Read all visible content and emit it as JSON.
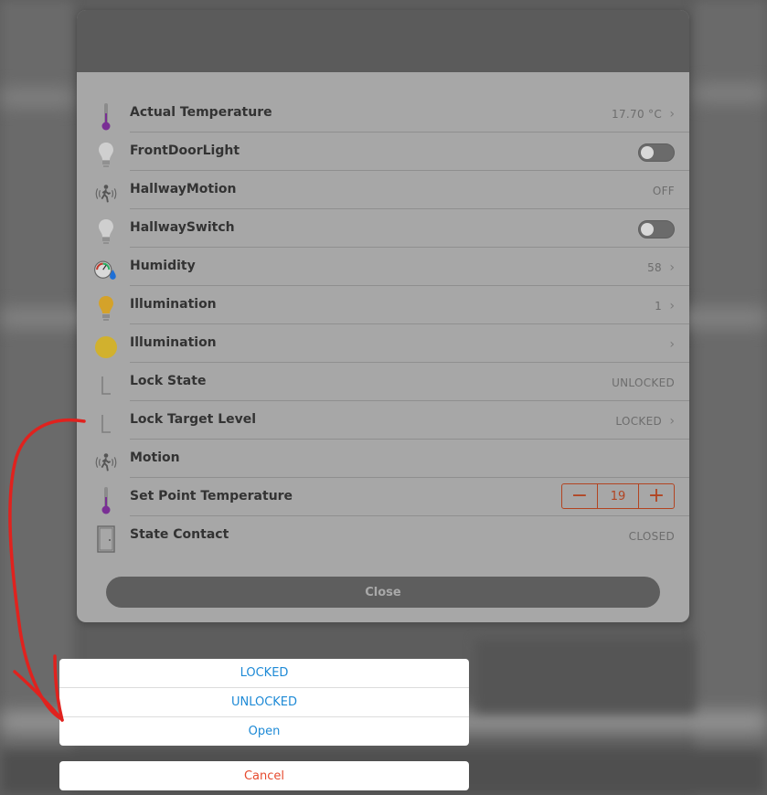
{
  "dialog": {
    "rows": [
      {
        "label": "Actual Temperature",
        "value": "17.70 °C",
        "icon": "thermometer-icon"
      },
      {
        "label": "FrontDoorLight",
        "icon": "lightbulb-icon"
      },
      {
        "label": "HallwayMotion",
        "value": "OFF",
        "icon": "motion-icon"
      },
      {
        "label": "HallwaySwitch",
        "icon": "lightbulb-icon"
      },
      {
        "label": "Humidity",
        "value": "58",
        "icon": "humidity-gauge-icon"
      },
      {
        "label": "Illumination",
        "value": "1",
        "icon": "lightbulb-on-icon"
      },
      {
        "label": "Illumination",
        "icon": "sun-icon"
      },
      {
        "label": "Lock State",
        "value": "UNLOCKED",
        "icon": "lock-state-icon"
      },
      {
        "label": "Lock Target Level",
        "value": "LOCKED",
        "icon": "lock-target-icon"
      },
      {
        "label": "Motion",
        "icon": "motion-icon"
      },
      {
        "label": "Set Point Temperature",
        "value": "19",
        "icon": "thermometer-icon"
      },
      {
        "label": "State Contact",
        "value": "CLOSED",
        "icon": "door-icon"
      }
    ],
    "close_label": "Close"
  },
  "action_sheet": {
    "options": [
      "LOCKED",
      "UNLOCKED",
      "Open"
    ],
    "cancel_label": "Cancel"
  },
  "colors": {
    "accent": "#b24421",
    "link": "#1e8ad6",
    "cancel": "#e64a2e",
    "annotation": "#e0221e"
  }
}
